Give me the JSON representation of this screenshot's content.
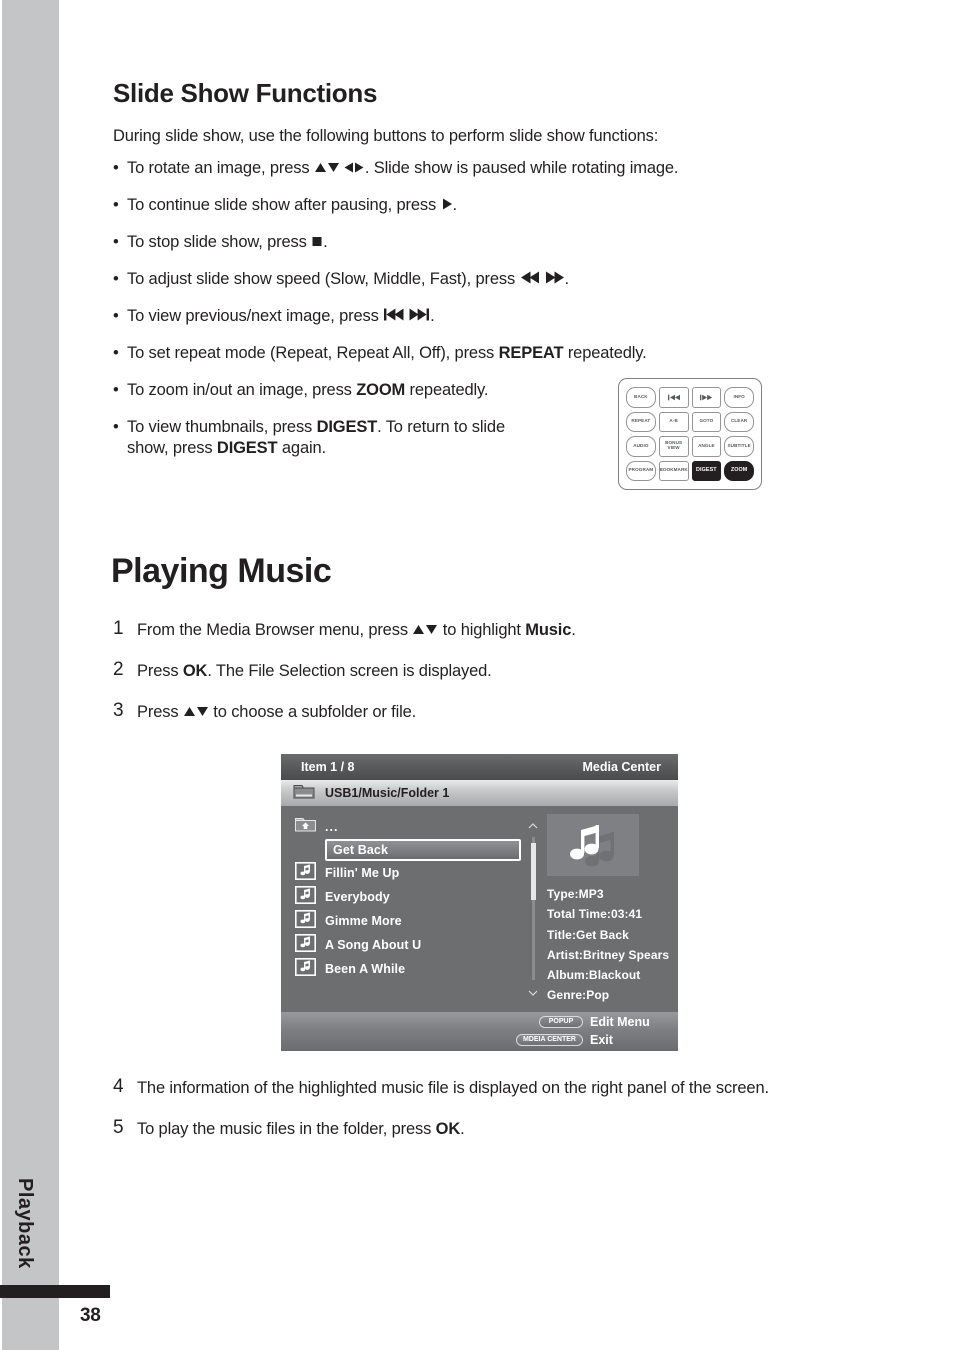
{
  "page": {
    "number": "38",
    "tab_label": "Playback"
  },
  "slide_show": {
    "title": "Slide Show Functions",
    "intro": "During slide show, use the following buttons to perform slide show functions:",
    "bullets": [
      {
        "pre": "To rotate an image, press ",
        "icons": [
          "up-arrow",
          "down-arrow",
          "left-arrow",
          "right-arrow"
        ],
        "post": ". Slide show is paused while rotating image."
      },
      {
        "pre": "To continue slide show after pausing, press ",
        "icons": [
          "play"
        ],
        "post": "."
      },
      {
        "pre": "To stop slide show, press ",
        "icons": [
          "stop"
        ],
        "post": "."
      },
      {
        "pre": "To adjust slide show speed (Slow, Middle, Fast), press ",
        "icons": [
          "rewind",
          "fast-forward"
        ],
        "post": "."
      },
      {
        "pre": "To view previous/next image, press ",
        "icons": [
          "skip-previous",
          "skip-next"
        ],
        "post": "."
      },
      {
        "pre": "To set repeat mode (Repeat, Repeat All, Off), press ",
        "bold": "REPEAT",
        "post": " repeatedly."
      },
      {
        "pre": "To zoom in/out an image, press ",
        "bold": "ZOOM",
        "post": " repeatedly."
      },
      {
        "pre": "To view thumbnails, press ",
        "bold": "DIGEST",
        "post": ". To return to slide show, press ",
        "bold2": "DIGEST",
        "post2": " again."
      }
    ]
  },
  "remote": {
    "buttons": [
      {
        "label": "BACK",
        "shape": "oval",
        "highlight": false
      },
      {
        "label": "",
        "shape": "rect",
        "highlight": false,
        "icon": "step-back"
      },
      {
        "label": "",
        "shape": "rect",
        "highlight": false,
        "icon": "step-forward"
      },
      {
        "label": "INFO",
        "shape": "oval",
        "highlight": false
      },
      {
        "label": "REPEAT",
        "shape": "oval",
        "highlight": false
      },
      {
        "label": "A-B",
        "shape": "rect",
        "highlight": false
      },
      {
        "label": "GOTO",
        "shape": "rect",
        "highlight": false
      },
      {
        "label": "CLEAR",
        "shape": "oval",
        "highlight": false
      },
      {
        "label": "AUDIO",
        "shape": "oval",
        "highlight": false
      },
      {
        "label": "BONUS VIEW",
        "shape": "rect",
        "highlight": false
      },
      {
        "label": "ANGLE",
        "shape": "rect",
        "highlight": false
      },
      {
        "label": "SUBTITLE",
        "shape": "oval",
        "highlight": false
      },
      {
        "label": "PROGRAM",
        "shape": "oval",
        "highlight": false
      },
      {
        "label": "BOOKMARK",
        "shape": "rect",
        "highlight": false
      },
      {
        "label": "DIGEST",
        "shape": "rect",
        "highlight": true
      },
      {
        "label": "ZOOM",
        "shape": "oval",
        "highlight": true
      }
    ]
  },
  "playing_music": {
    "title": "Playing Music",
    "steps_top": [
      {
        "num": "1",
        "pre": "From the Media Browser menu, press ",
        "icons": [
          "up-arrow",
          "down-arrow"
        ],
        "post": " to highlight ",
        "bold": "Music",
        "post2": "."
      },
      {
        "num": "2",
        "pre": "Press ",
        "bold": "OK",
        "post": ". The File Selection screen is displayed."
      },
      {
        "num": "3",
        "pre": "Press ",
        "icons": [
          "up-arrow",
          "down-arrow"
        ],
        "post": " to choose a subfolder or file."
      }
    ],
    "steps_bottom": [
      {
        "num": "4",
        "pre": "The information of the highlighted music file is displayed on the right panel of the screen."
      },
      {
        "num": "5",
        "pre": "To play the music files in the folder, press ",
        "bold": "OK",
        "post": "."
      }
    ]
  },
  "media_screen": {
    "header_left": "Item 1 / 8",
    "header_right": "Media Center",
    "path": "USB1/Music/Folder 1",
    "files": [
      {
        "name": "...",
        "icon": "parent-folder-icon",
        "selected": false
      },
      {
        "name": "Get Back",
        "icon": "music-file-icon",
        "selected": true
      },
      {
        "name": "Fillin' Me Up",
        "icon": "music-file-icon",
        "selected": false
      },
      {
        "name": "Everybody",
        "icon": "music-file-icon",
        "selected": false
      },
      {
        "name": "Gimme More",
        "icon": "music-file-icon",
        "selected": false
      },
      {
        "name": "A Song About U",
        "icon": "music-file-icon",
        "selected": false
      },
      {
        "name": "Been A While",
        "icon": "music-file-icon",
        "selected": false
      }
    ],
    "metadata": [
      "Type:MP3",
      "Total Time:03:41",
      "Title:Get Back",
      "Artist:Britney Spears",
      "Album:Blackout",
      "Genre:Pop"
    ],
    "footer": [
      {
        "key": "POPUP",
        "action": "Edit Menu"
      },
      {
        "key": "MDEIA CENTER",
        "action": "Exit"
      }
    ]
  },
  "colors": {
    "band_gray": "#c3c5c7",
    "ink": "#231f20",
    "screen_bg": "#6d6e70",
    "screen_header": "#58595b",
    "screen_path": "#c8c9ca"
  }
}
